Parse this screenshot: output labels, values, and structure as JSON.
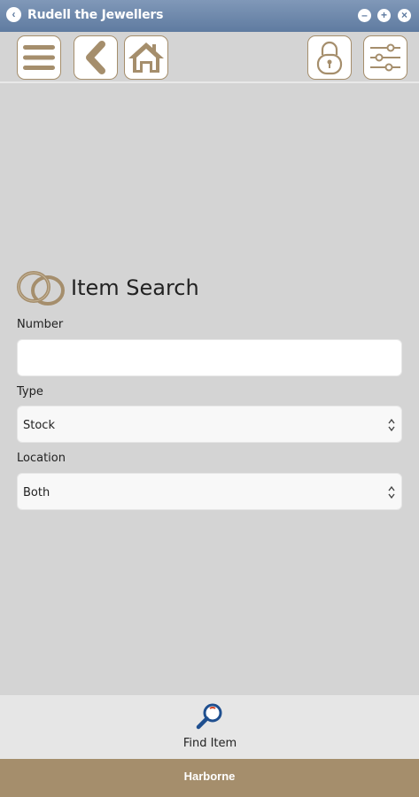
{
  "window": {
    "title": "Rudell the Jewellers"
  },
  "toolbar": {
    "icons": [
      "menu-icon",
      "back-icon",
      "home-icon",
      "lock-icon",
      "settings-sliders-icon"
    ]
  },
  "form": {
    "heading": "Item Search",
    "number_label": "Number",
    "number_value": "",
    "type_label": "Type",
    "type_value": "Stock",
    "location_label": "Location",
    "location_value": "Both"
  },
  "actions": {
    "find_label": "Find Item"
  },
  "footer": {
    "branch": "Harborne"
  },
  "colors": {
    "accent": "#a58e6c",
    "titlebar": "#6a85a9",
    "background": "#d4d4d4",
    "find_icon": "#1f4f8f"
  }
}
